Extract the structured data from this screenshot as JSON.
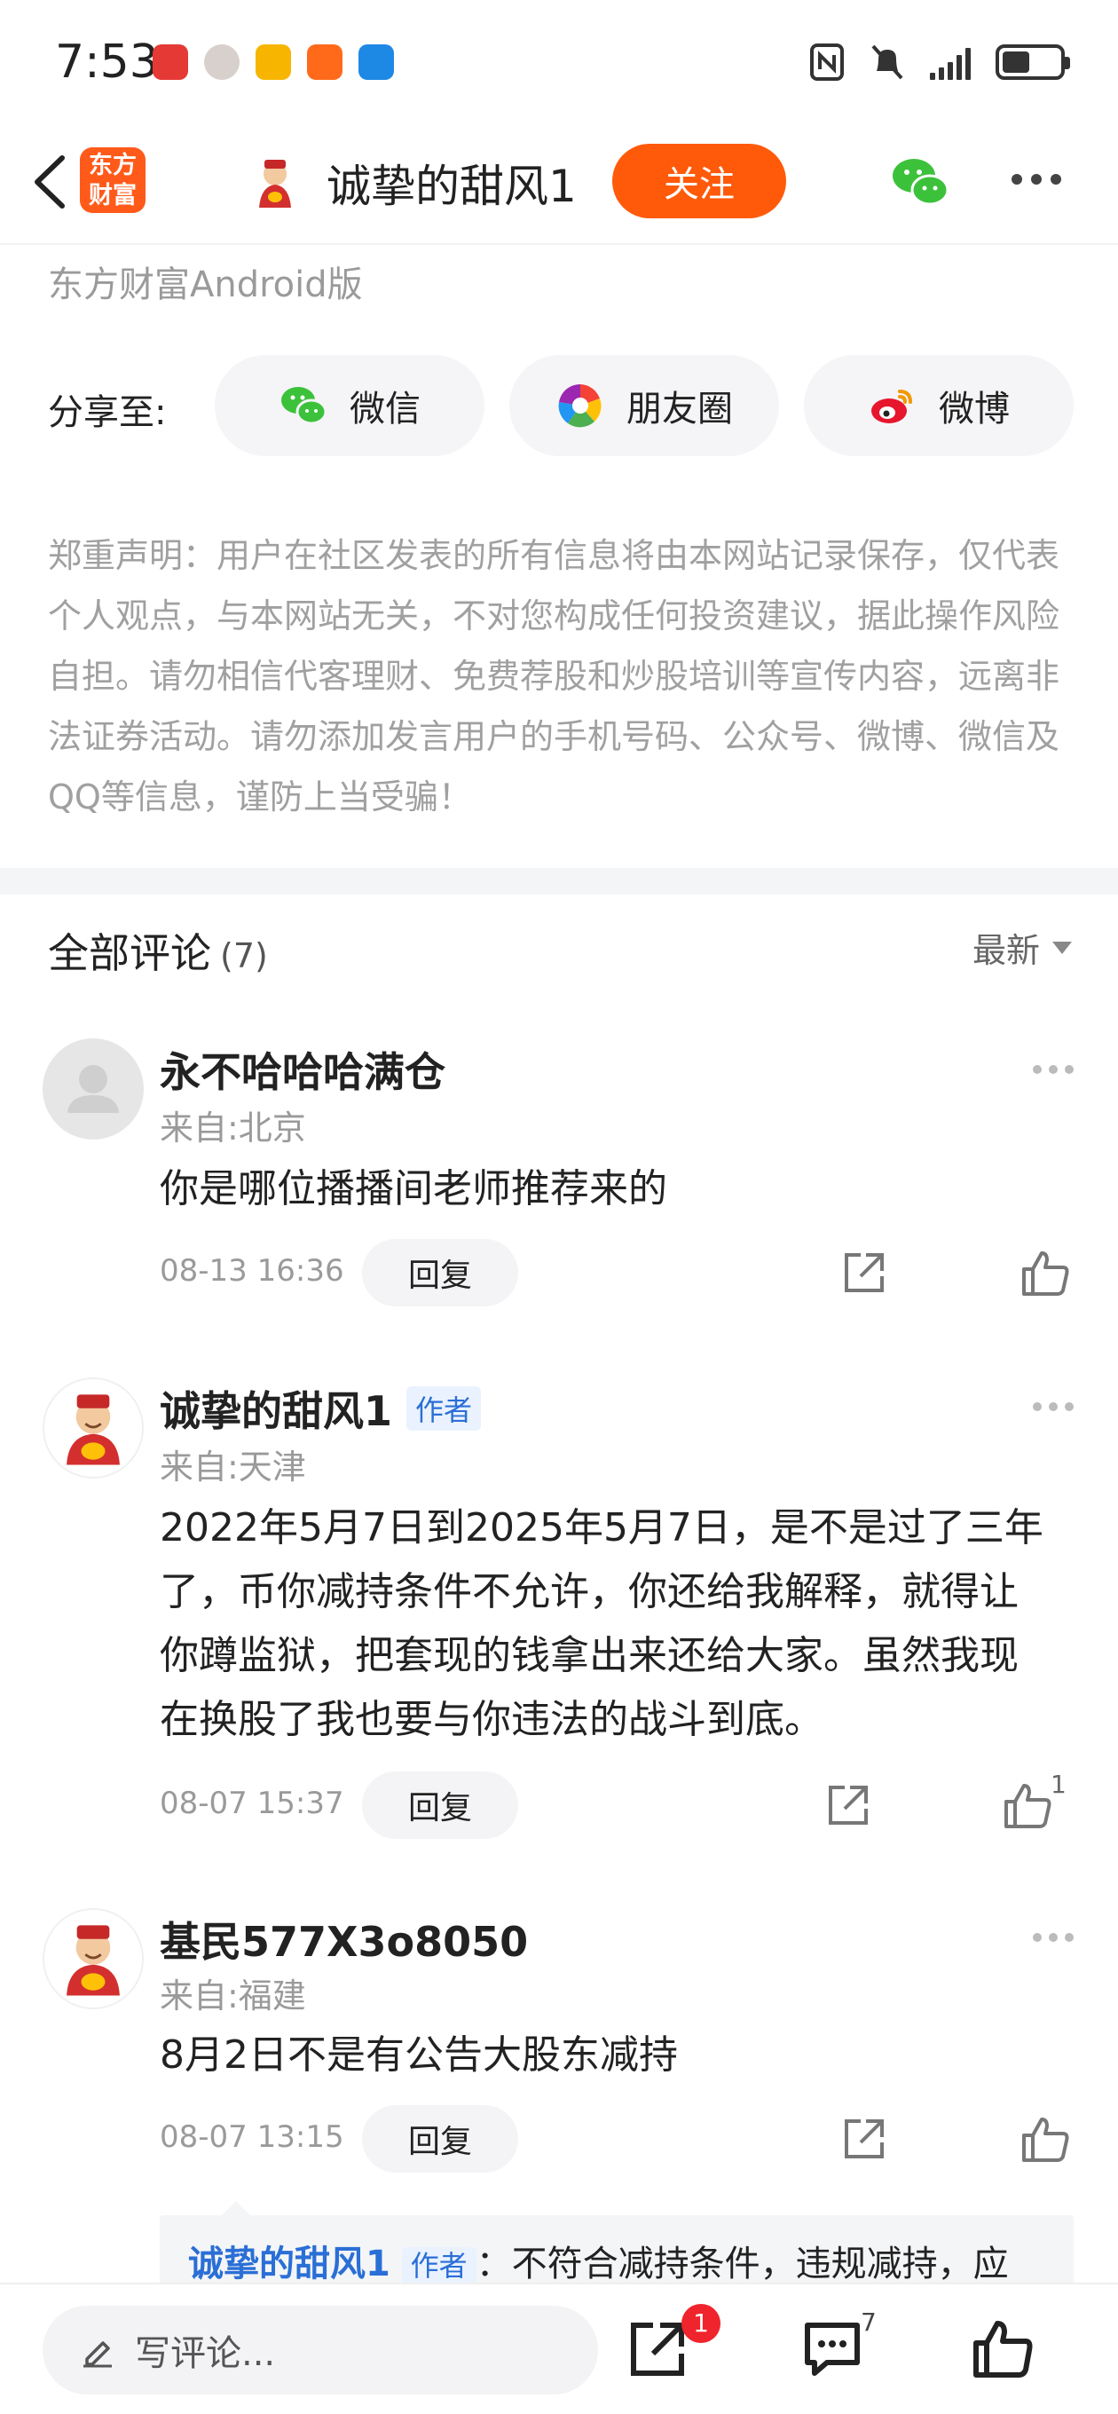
{
  "status": {
    "time": "7:53"
  },
  "header": {
    "logo_text": "东方财富",
    "author_name": "诚挚的甜风1",
    "follow_label": "关注"
  },
  "source": "东方财富Android版",
  "share": {
    "label": "分享至:",
    "items": [
      {
        "label": "微信",
        "icon": "wechat-icon"
      },
      {
        "label": "朋友圈",
        "icon": "moments-icon"
      },
      {
        "label": "微博",
        "icon": "weibo-icon"
      }
    ]
  },
  "disclaimer": "郑重声明：用户在社区发表的所有信息将由本网站记录保存，仅代表个人观点，与本网站无关，不对您构成任何投资建议，据此操作风险自担。请勿相信代客理财、免费荐股和炒股培训等宣传内容，远离非法证券活动。请勿添加发言用户的手机号码、公众号、微博、微信及QQ等信息，谨防上当受骗！",
  "comments_header": {
    "title": "全部评论",
    "count": "(7)",
    "sort": "最新"
  },
  "comments": [
    {
      "name": "永不哈哈哈满仓",
      "badge": "",
      "location": "来自:北京",
      "text": "你是哪位播播间老师推荐来的",
      "time": "08-13 16:36",
      "reply_label": "回复",
      "likes": ""
    },
    {
      "name": "诚挚的甜风1",
      "badge": "作者",
      "location": "来自:天津",
      "text": "2022年5月7日到2025年5月7日，是不是过了三年了，币你减持条件不允许，你还给我解释，就得让你蹲监狱，把套现的钱拿出来还给大家。虽然我现在换股了我也要与你违法的战斗到底。",
      "time": "08-07 15:37",
      "reply_label": "回复",
      "likes": "1"
    },
    {
      "name": "基民577X3o8050",
      "badge": "",
      "location": "来自:福建",
      "text": "8月2日不是有公告大股东减持",
      "time": "08-07 13:15",
      "reply_label": "回复",
      "likes": ""
    }
  ],
  "subreply": {
    "name": "诚挚的甜风1",
    "badge": "作者",
    "text": "：不符合减持条件，违规减持，应"
  },
  "bottom": {
    "placeholder": "写评论...",
    "share_badge": "1",
    "comment_count": "7"
  },
  "colors": {
    "brand_orange": "#ff5a0a",
    "link_blue": "#2a6fd6",
    "badge_red": "#f0242c"
  }
}
